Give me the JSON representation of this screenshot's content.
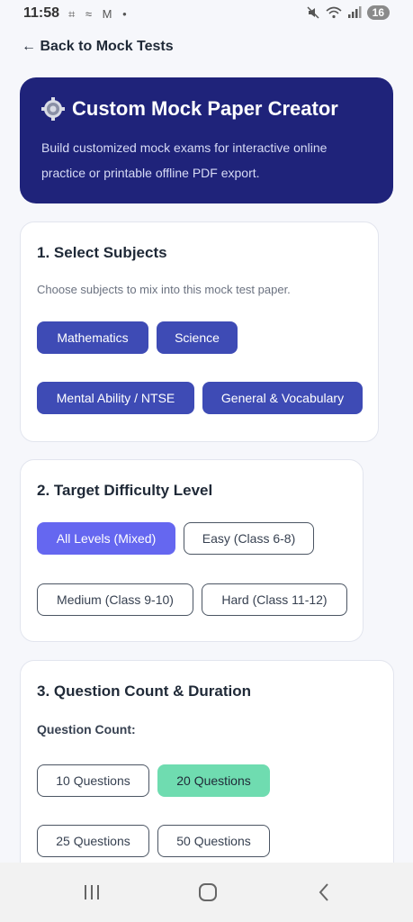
{
  "status": {
    "time": "11:58",
    "left_icons": "⌗ ≈ M •",
    "battery": "16"
  },
  "nav": {
    "back_label": "← Back to Mock Tests"
  },
  "hero": {
    "title": "Custom Mock Paper Creator",
    "description": "Build customized mock exams for interactive online practice or printable offline PDF export."
  },
  "subjects": {
    "title": "1. Select Subjects",
    "subtitle": "Choose subjects to mix into this mock test paper.",
    "options": [
      "Mathematics",
      "Science",
      "Mental Ability / NTSE",
      "General & Vocabulary"
    ]
  },
  "difficulty": {
    "title": "2. Target Difficulty Level",
    "options": [
      "All Levels (Mixed)",
      "Easy (Class 6-8)",
      "Medium (Class 9-10)",
      "Hard (Class 11-12)"
    ],
    "selected": "All Levels (Mixed)"
  },
  "count": {
    "title": "3. Question Count & Duration",
    "label": "Question Count:",
    "options": [
      "10 Questions",
      "20 Questions",
      "25 Questions",
      "50 Questions"
    ],
    "selected": "20 Questions"
  },
  "colors": {
    "hero_bg": "#1f237a",
    "chip_selected_subject": "#3e4bb5",
    "chip_selected_difficulty": "#6567f0",
    "chip_selected_count": "#6fdcb0"
  }
}
